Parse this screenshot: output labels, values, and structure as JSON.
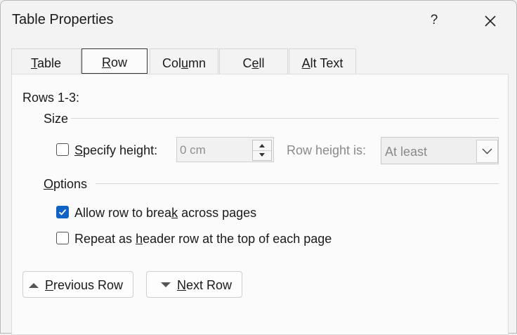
{
  "dialog": {
    "title": "Table Properties",
    "help_label": "?"
  },
  "tabs": [
    {
      "pre": "",
      "mnemonic": "T",
      "post": "able"
    },
    {
      "pre": "",
      "mnemonic": "R",
      "post": "ow"
    },
    {
      "pre": "Col",
      "mnemonic": "u",
      "post": "mn"
    },
    {
      "pre": "C",
      "mnemonic": "e",
      "post": "ll"
    },
    {
      "pre": "",
      "mnemonic": "A",
      "post": "lt Text"
    }
  ],
  "rows_label": "Rows 1-3:",
  "size": {
    "heading": "Size",
    "specify_height": {
      "mnemonic": "S",
      "post": "pecify height:",
      "checked": false
    },
    "height_value": "0 cm",
    "row_height_is_label": "Row height is:",
    "row_height_is_value": "At least"
  },
  "options": {
    "heading_mnemonic": "O",
    "heading_post": "ptions",
    "allow_break": {
      "pre": "Allow row to brea",
      "mnemonic": "k",
      "post": " across pages",
      "checked": true
    },
    "repeat_header": {
      "pre": "Repeat as ",
      "mnemonic": "h",
      "post": "eader row at the top of each page",
      "checked": false
    }
  },
  "nav": {
    "previous": {
      "mnemonic": "P",
      "post": "revious Row"
    },
    "next": {
      "mnemonic": "N",
      "post": "ext Row"
    }
  }
}
